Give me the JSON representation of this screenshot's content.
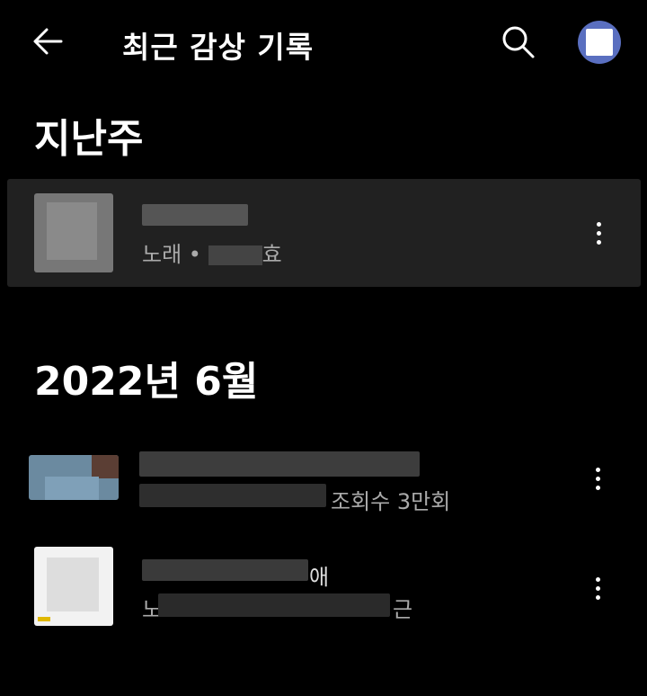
{
  "header": {
    "title": "최근 감상 기록",
    "back_icon": "arrow-left-icon",
    "search_icon": "search-icon",
    "avatar_color": "#5a6fc0"
  },
  "sections": [
    {
      "heading": "지난주",
      "items": [
        {
          "subtitle_prefix": "노래 •",
          "subtitle_suffix": "효"
        }
      ]
    },
    {
      "heading": "2022년 6월",
      "items": [
        {
          "subtitle_suffix": "조회수 3만회"
        },
        {
          "subtitle_prefix": "노",
          "title_suffix": "애",
          "subtitle_suffix": "근"
        }
      ]
    }
  ],
  "colors": {
    "background": "#000000",
    "highlight_row": "#212121",
    "secondary_text": "#aaaaaa"
  }
}
